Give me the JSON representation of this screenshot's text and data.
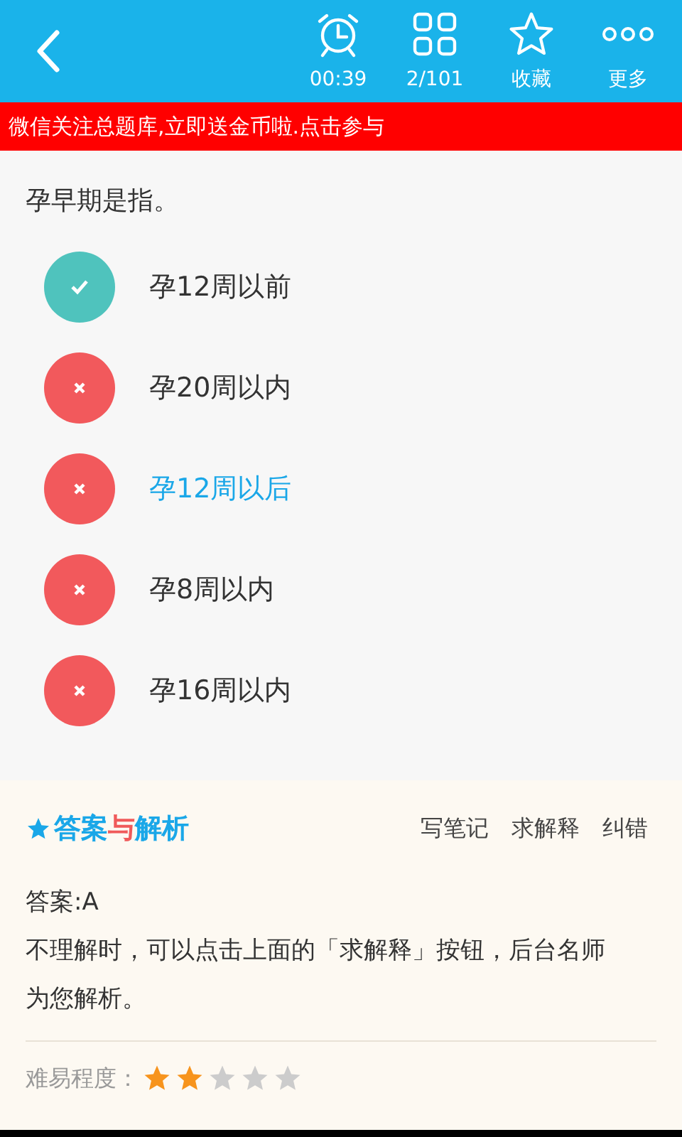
{
  "toolbar": {
    "items": [
      {
        "kind": "timer",
        "label": "00:39"
      },
      {
        "kind": "grid",
        "label": "2/101"
      },
      {
        "kind": "star",
        "label": "收藏"
      },
      {
        "kind": "more",
        "label": "更多"
      }
    ]
  },
  "banner": "微信关注总题库,立即送金币啦.点击参与",
  "question": "孕早期是指。",
  "options": [
    {
      "text": "孕12周以前",
      "kind": "correct",
      "selected": false
    },
    {
      "text": "孕20周以内",
      "kind": "wrong",
      "selected": false
    },
    {
      "text": "孕12周以后",
      "kind": "wrong",
      "selected": true
    },
    {
      "text": "孕8周以内",
      "kind": "wrong",
      "selected": false
    },
    {
      "text": "孕16周以内",
      "kind": "wrong",
      "selected": false
    }
  ],
  "analysis": {
    "title_parts": [
      {
        "text": "答案",
        "color": "#1aa7e8"
      },
      {
        "text": "与",
        "color": "#f05a5a"
      },
      {
        "text": "解析",
        "color": "#1aa7e8"
      }
    ],
    "actions": [
      "写笔记",
      "求解释",
      "纠错"
    ],
    "answer": "答案:A",
    "explanation": "不理解时，可以点击上面的「求解释」按钮，后台名师为您解析。",
    "difficulty_label": "难易程度：",
    "stars": 2
  }
}
